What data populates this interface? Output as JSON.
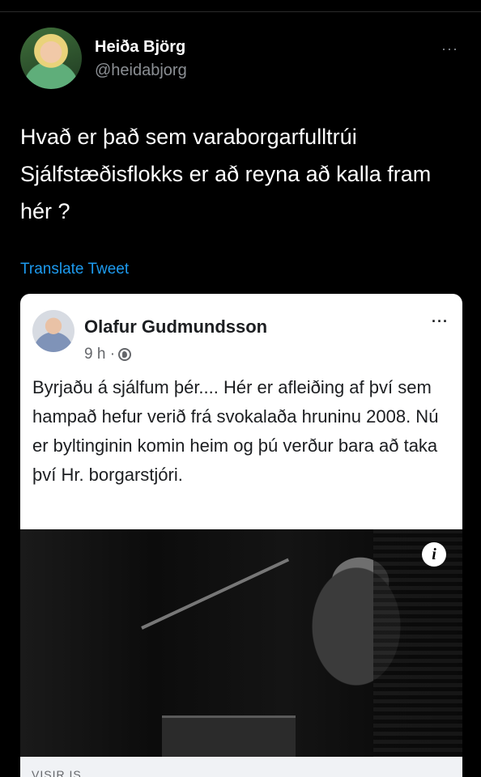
{
  "tweet": {
    "author_name": "Heiða Björg",
    "author_handle": "@heidabjorg",
    "more_label": "···",
    "text": "Hvað er það sem varaborgarfulltrúi Sjálfstæðisflokks er að reyna að kalla fram hér ?",
    "translate_label": "Translate Tweet"
  },
  "embedded_post": {
    "author_name": "Olafur Gudmundsson",
    "time": "9 h ·",
    "more_label": "···",
    "text": "Byrjaðu á sjálfum þér....  Hér er afleiðing af því sem hampað hefur verið frá svokalaða hruninu 2008.  Nú er byltinginin komin heim og þú verður bara að taka því Hr. borgarstjóri.",
    "info_label": "i",
    "link_domain": "VISIR.IS"
  },
  "icons": {
    "audience": "globe-icon",
    "info": "info-icon"
  },
  "colors": {
    "background": "#000000",
    "link": "#1d9bf0",
    "secondary_text": "#8b8f94",
    "card_background": "#ffffff"
  }
}
